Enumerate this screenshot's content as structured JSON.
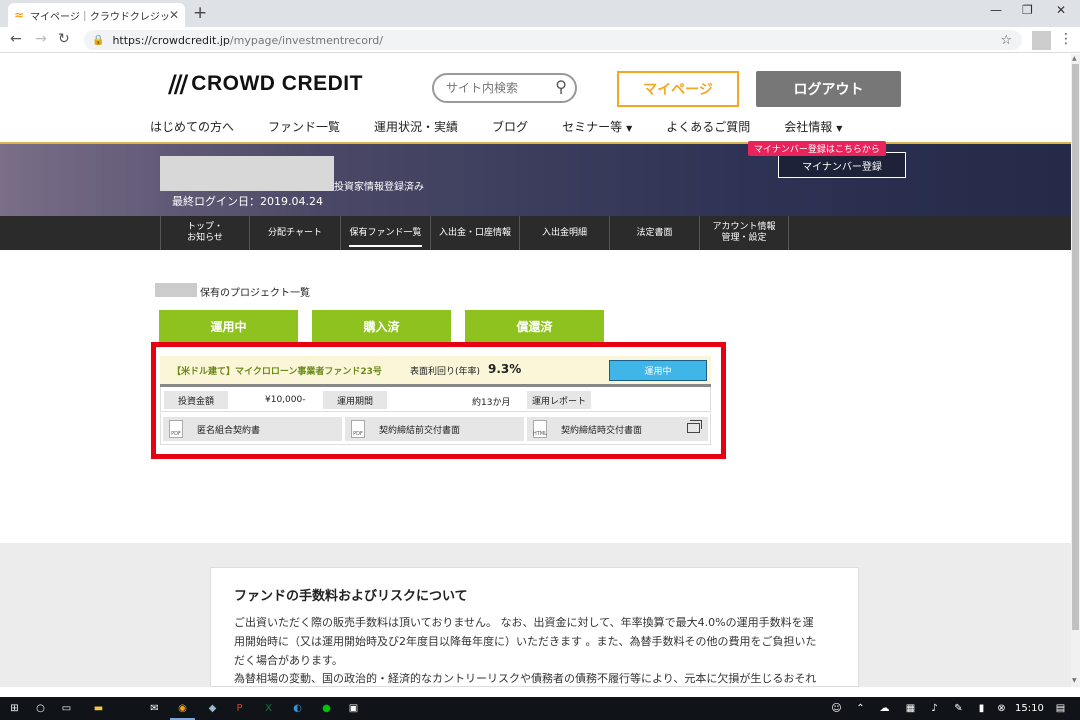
{
  "browser": {
    "tab_title": "マイページ｜クラウドクレジット",
    "tab_favicon": "crowdcredit-favicon",
    "new_tab": "+",
    "url_host": "https://crowdcredit.jp",
    "url_path": "/mypage/investmentrecord/",
    "window_controls": [
      "—",
      "❐",
      "✕"
    ]
  },
  "header": {
    "logo_text": "CROWD CREDIT",
    "search_placeholder": "サイト内検索",
    "mypage_label": "マイページ",
    "logout_label": "ログアウト",
    "nav": [
      "はじめての方へ",
      "ファンド一覧",
      "運用状況・実績",
      "ブログ",
      "セミナー等",
      "よくあるご質問",
      "会社情報"
    ]
  },
  "banner": {
    "investor_status": "投資家情報登録済み",
    "last_login": "最終ログイン日：2019.04.24",
    "mynumber_tip": "マイナンバー登録はこちらから",
    "mynumber_button": "マイナンバー登録"
  },
  "subnav": [
    {
      "line1": "トップ・",
      "line2": "お知らせ"
    },
    {
      "line1": "分配チャート",
      "line2": ""
    },
    {
      "line1": "保有ファンド一覧",
      "line2": ""
    },
    {
      "line1": "入出金・口座情報",
      "line2": ""
    },
    {
      "line1": "入出金明細",
      "line2": ""
    },
    {
      "line1": "法定書面",
      "line2": ""
    },
    {
      "line1": "アカウント情報",
      "line2": "管理・設定"
    }
  ],
  "content": {
    "list_title": "保有のプロジェクト一覧",
    "status_tabs": [
      "運用中",
      "購入済",
      "償還済"
    ],
    "fund": {
      "name": "【米ドル建て】マイクロローン事業者ファンド23号",
      "yield_label": "表面利回り(年率)",
      "yield_value": "9.3%",
      "status": "運用中",
      "amount_label": "投資金額",
      "amount_value": "¥10,000-",
      "period_label": "運用期間",
      "period_value": "約13か月",
      "report_label": "運用レポート",
      "docs": [
        {
          "type": "PDF",
          "label": "匿名組合契約書"
        },
        {
          "type": "PDF",
          "label": "契約締結前交付書面"
        },
        {
          "type": "HTML",
          "label": "契約締結時交付書面"
        }
      ]
    }
  },
  "fees": {
    "title": "ファンドの手数料およびリスクについて",
    "lines": [
      "ご出資いただく際の販売手数料は頂いておりません。 なお、出資金に対して、年率換算で最大4.0%の運用手数料を運",
      "用開始時に（又は運用開始時及び2年度目以降毎年度に）いただきます 。また、為替手数料その他の費用をご負担いた",
      "だく場合があります。",
      "為替相場の変動、国の政治的・経済的なカントリーリスクや債務者の債務不履行等により、元本に欠損が生じるおそれ"
    ]
  },
  "taskbar": {
    "clock": "15:10"
  },
  "colors": {
    "accent_orange": "#f5a623",
    "status_green": "#8dc21f",
    "highlight_red": "#e60012",
    "status_blue": "#3fb5e8"
  }
}
